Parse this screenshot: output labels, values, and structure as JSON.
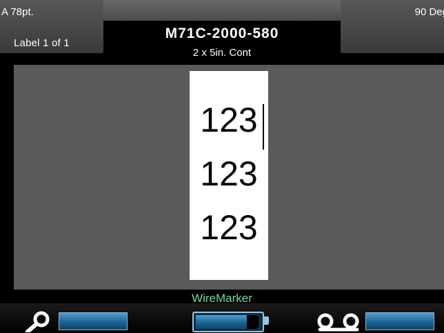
{
  "header": {
    "font_size": "A 78pt.",
    "rotation": "90 Deg",
    "label_count": "Label  1 of 1",
    "part_number": "M71C-2000-580",
    "label_size": "2 x 5in.  Cont"
  },
  "label": {
    "lines": [
      "123",
      "123",
      "123"
    ],
    "background": "#ffffff"
  },
  "footer": {
    "label_type": "WireMarker",
    "label_type_color": "#7fd39a"
  },
  "status": {
    "left_icon": "magnifier-icon",
    "right_icon": "tape-reel-icon",
    "battery_icon": "battery-icon",
    "left_meter_level": 1.0,
    "right_meter_level": 1.0,
    "battery_level": 0.8,
    "accent_color": "#1e6390"
  }
}
